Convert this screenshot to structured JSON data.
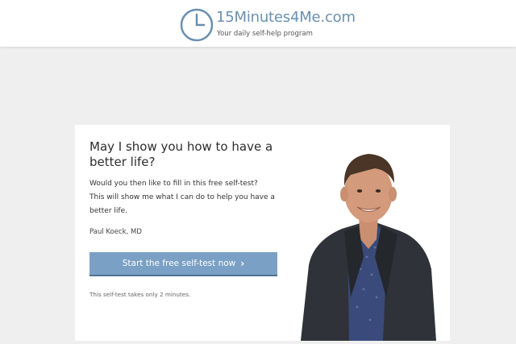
{
  "header": {
    "site_title": "15Minutes4Me.com",
    "tagline": "Your daily self-help program",
    "logo_icon": "clock-icon",
    "brand_color": "#6a8fb0"
  },
  "card": {
    "headline": "May I show you how to have a better life?",
    "body_lines": [
      "Would you then like to fill in this free self-test?",
      "This will show me what I can do to help you have a",
      "better life."
    ],
    "author": "Paul Koeck, MD",
    "cta_label": "Start the free self-test now",
    "cta_icon": "chevron-right-icon",
    "cta_color": "#7aa0c5",
    "note": "This self-test takes only 2 minutes.",
    "photo_icon": "person-portrait-image"
  }
}
